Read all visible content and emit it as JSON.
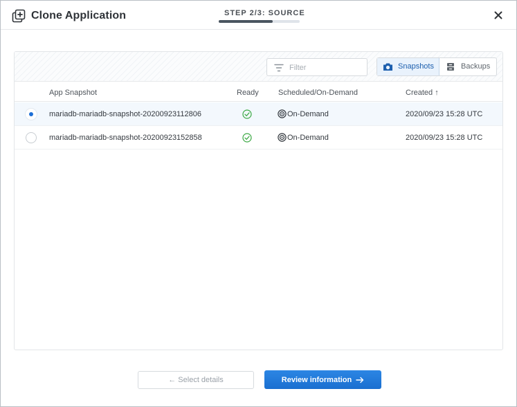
{
  "header": {
    "title": "Clone Application",
    "step_label": "STEP 2/3: SOURCE",
    "step_progress": 0.67
  },
  "toolbar": {
    "filter_placeholder": "Filter",
    "filter_value": "",
    "segments": [
      {
        "label": "Snapshots",
        "icon": "camera-icon",
        "active": true
      },
      {
        "label": "Backups",
        "icon": "archive-icon",
        "active": false
      }
    ]
  },
  "table": {
    "columns": {
      "name": "App Snapshot",
      "ready": "Ready",
      "schedule": "Scheduled/On-Demand",
      "created": "Created ↑"
    },
    "rows": [
      {
        "name": "mariadb-mariadb-snapshot-20200923112806",
        "ready": true,
        "schedule": "On-Demand",
        "created": "2020/09/23 15:28 UTC",
        "selected": true
      },
      {
        "name": "mariadb-mariadb-snapshot-20200923152858",
        "ready": true,
        "schedule": "On-Demand",
        "created": "2020/09/23 15:28 UTC",
        "selected": false
      }
    ]
  },
  "footer": {
    "back_label": "← Select details",
    "next_label": "Review information"
  },
  "colors": {
    "accent": "#1a6fd0",
    "success": "#3aa843",
    "selected_row": "#f3f8fd"
  }
}
